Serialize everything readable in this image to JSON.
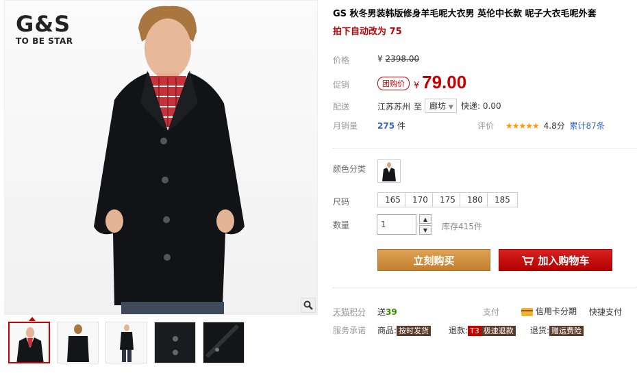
{
  "brand": {
    "name": "G&S",
    "tagline": "TO BE STAR"
  },
  "product": {
    "title": "GS 秋冬男装韩版修身羊毛呢大衣男 英伦中长款 呢子大衣毛呢外套",
    "promo_line": "拍下自动改为 75"
  },
  "price": {
    "label": "价格",
    "currency": "¥",
    "original": "2398.00"
  },
  "promo": {
    "label": "促销",
    "badge": "团购价",
    "currency": "¥",
    "amount": "79.00"
  },
  "shipping": {
    "label": "配送",
    "origin": "江苏苏州",
    "to_word": "至",
    "destination": "廊坊",
    "fee_label": "快递:",
    "fee": "0.00"
  },
  "sales": {
    "label": "月销量",
    "count": "275",
    "unit": "件",
    "rating_label": "评价",
    "stars": "★★★★★",
    "score": "4.8分",
    "reviews": "累计87条"
  },
  "options": {
    "color_label": "颜色分类",
    "size_label": "尺码",
    "sizes": [
      "165",
      "170",
      "175",
      "180",
      "185"
    ],
    "qty_label": "数量",
    "qty_value": "1",
    "stock": "库存415件"
  },
  "actions": {
    "buy_now": "立刻购买",
    "add_cart": "加入购物车"
  },
  "points": {
    "label": "天猫积分",
    "prefix": "送",
    "value": "39",
    "pay_label": "支付",
    "credit": "信用卡分期",
    "quick": "快捷支付"
  },
  "service": {
    "label": "服务承诺",
    "goods_label": "商品:",
    "goods_tag": "按时发货",
    "refund_label": "退款:",
    "refund_prefix": "T3",
    "refund_tag": "极速退款",
    "return_label": "退货:",
    "return_tag": "赠运费险"
  },
  "colors": {
    "accent_red": "#c40000",
    "buy_orange": "#cf8a3c",
    "cart_red": "#c40000"
  }
}
